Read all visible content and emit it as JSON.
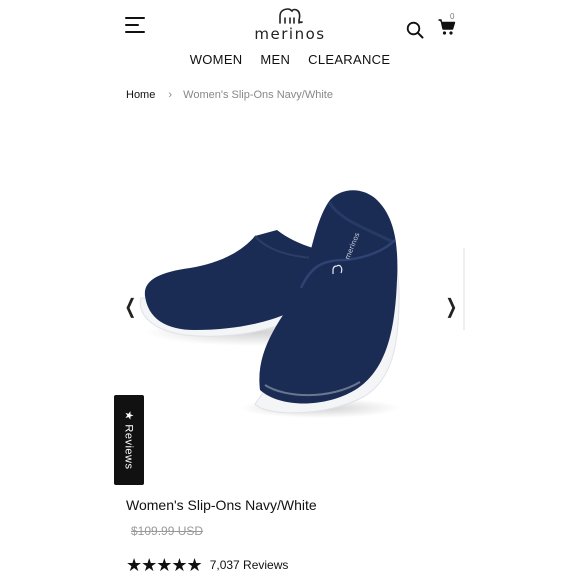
{
  "header": {
    "logo_text": "merinos",
    "cart_count": "0",
    "nav": [
      "WOMEN",
      "MEN",
      "CLEARANCE"
    ]
  },
  "breadcrumb": {
    "home": "Home",
    "separator": "›",
    "current": "Women's Slip-Ons Navy/White"
  },
  "gallery": {
    "prev": "❮",
    "next": "❯",
    "shoe_brand_text": "merinos"
  },
  "reviews_tab": {
    "star": "★",
    "label": "Reviews"
  },
  "product": {
    "title": "Women's Slip-Ons Navy/White",
    "original_price": "$109.99 USD",
    "stars": "★★★★★",
    "rating": 4.8,
    "review_count": "7,037 Reviews"
  },
  "colors": {
    "navy": "#1b2c54",
    "sole": "#f4f5f7",
    "text": "#111111",
    "muted": "#888888"
  }
}
